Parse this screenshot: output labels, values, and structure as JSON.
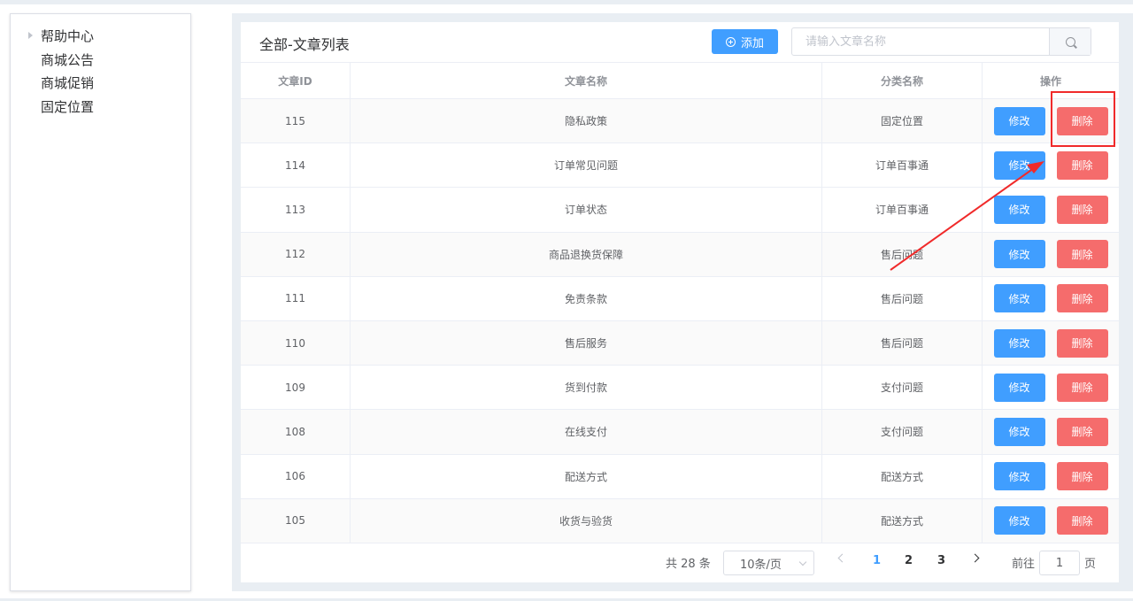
{
  "sidebar": {
    "root": "帮助中心",
    "children": [
      "商城公告",
      "商城促销",
      "固定位置"
    ]
  },
  "header": {
    "title": "全部-文章列表",
    "add_label": "添加",
    "search_placeholder": "请输入文章名称"
  },
  "table": {
    "columns": [
      "文章ID",
      "文章名称",
      "分类名称",
      "操作"
    ],
    "rows": [
      {
        "id": "115",
        "name": "隐私政策",
        "category": "固定位置"
      },
      {
        "id": "114",
        "name": "订单常见问题",
        "category": "订单百事通"
      },
      {
        "id": "113",
        "name": "订单状态",
        "category": "订单百事通"
      },
      {
        "id": "112",
        "name": "商品退换货保障",
        "category": "售后问题"
      },
      {
        "id": "111",
        "name": "免责条款",
        "category": "售后问题"
      },
      {
        "id": "110",
        "name": "售后服务",
        "category": "售后问题"
      },
      {
        "id": "109",
        "name": "货到付款",
        "category": "支付问题"
      },
      {
        "id": "108",
        "name": "在线支付",
        "category": "支付问题"
      },
      {
        "id": "106",
        "name": "配送方式",
        "category": "配送方式"
      },
      {
        "id": "105",
        "name": "收货与验货",
        "category": "配送方式"
      }
    ],
    "edit_label": "修改",
    "delete_label": "删除"
  },
  "pagination": {
    "total": "共 28 条",
    "page_size": "10条/页",
    "pages": [
      "1",
      "2",
      "3"
    ],
    "current": "1",
    "goto_label": "前往",
    "goto_value": "1",
    "goto_suffix": "页"
  },
  "colors": {
    "primary": "#409eff",
    "danger": "#f56c6c",
    "annotation": "#f02a2a"
  }
}
